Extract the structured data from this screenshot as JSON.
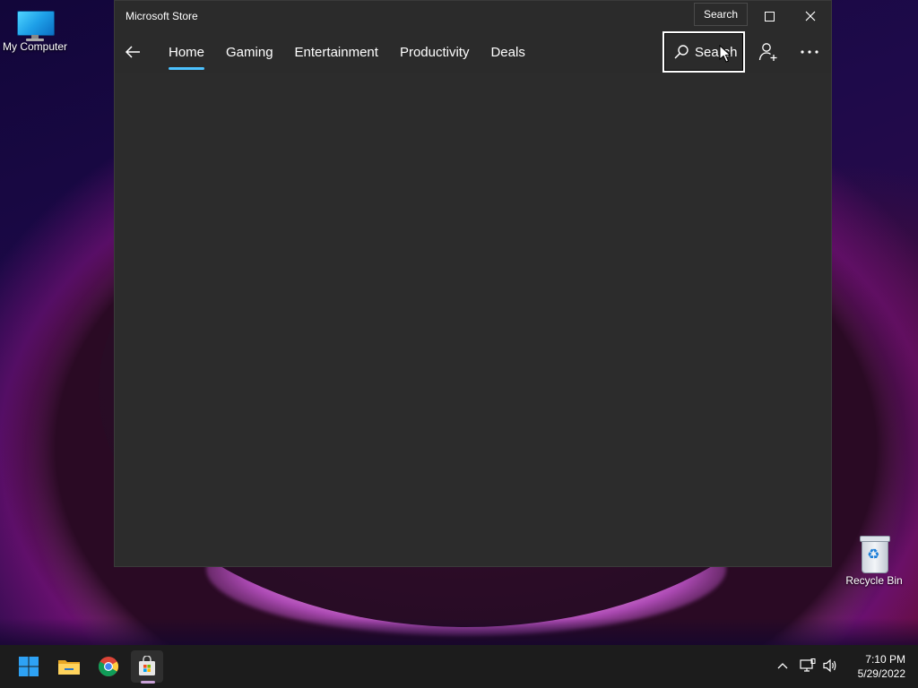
{
  "desktop": {
    "icons": [
      {
        "label": "My Computer"
      },
      {
        "label": "Recycle Bin"
      }
    ]
  },
  "window": {
    "title": "Microsoft Store",
    "tooltip": "Search",
    "nav": {
      "tabs": [
        {
          "label": "Home",
          "active": true
        },
        {
          "label": "Gaming"
        },
        {
          "label": "Entertainment"
        },
        {
          "label": "Productivity"
        },
        {
          "label": "Deals"
        }
      ],
      "search_label": "Search"
    }
  },
  "taskbar": {
    "apps": [
      "windows-start-icon",
      "file-explorer-icon",
      "chrome-icon",
      "microsoft-store-icon"
    ],
    "clock": {
      "time": "7:10 PM",
      "date": "5/29/2022"
    }
  },
  "colors": {
    "accent": "#4cc2ff",
    "window_bg": "#2b2b2b",
    "taskbar_bg": "#1c1c1c"
  }
}
